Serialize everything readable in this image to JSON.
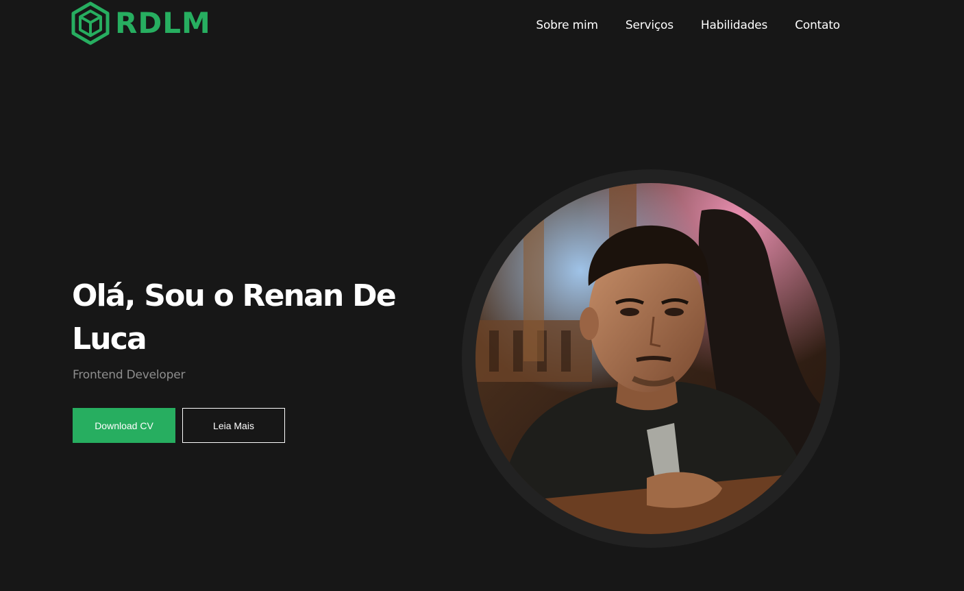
{
  "brand": {
    "logo_text": "RDLM",
    "accent_color": "#27ae60",
    "logo_icon": "hexagon-cube-icon"
  },
  "nav": {
    "items": [
      {
        "label": "Sobre mim"
      },
      {
        "label": "Serviços"
      },
      {
        "label": "Habilidades"
      },
      {
        "label": "Contato"
      }
    ]
  },
  "hero": {
    "title": "Olá, Sou o Renan De Luca",
    "subtitle": "Frontend Developer",
    "primary_button": "Download CV",
    "secondary_button": "Leia Mais"
  },
  "colors": {
    "background": "#171717",
    "text": "#ffffff",
    "muted_text": "#8e8e8e",
    "avatar_ring": "#222222"
  }
}
